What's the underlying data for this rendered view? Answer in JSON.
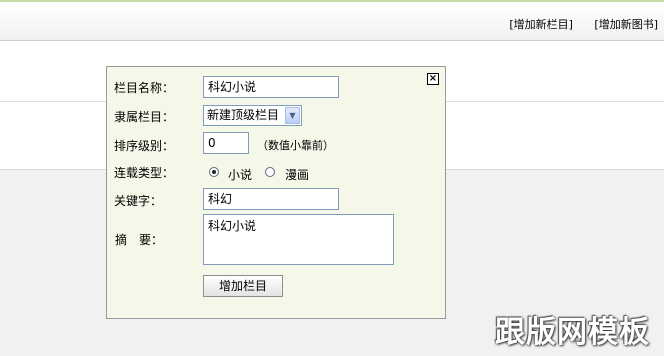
{
  "toolbar": {
    "add_category": "[增加新栏目]",
    "add_book": "[增加新图书]"
  },
  "dialog": {
    "close_glyph": "×",
    "name_label": "栏目名称：",
    "name_value": "科幻小说",
    "parent_label": "隶属栏目：",
    "parent_value": "新建顶级栏目",
    "order_label": "排序级别：",
    "order_value": "0",
    "order_hint": "（数值小靠前）",
    "type_label": "连载类型：",
    "type_options": [
      "小说",
      "漫画"
    ],
    "type_selected": "小说",
    "keyword_label": "关键字：",
    "keyword_value": "科幻",
    "summary_label": "摘　要：",
    "summary_value": "科幻小说",
    "submit_label": "增加栏目"
  },
  "watermark": "跟版网模板"
}
